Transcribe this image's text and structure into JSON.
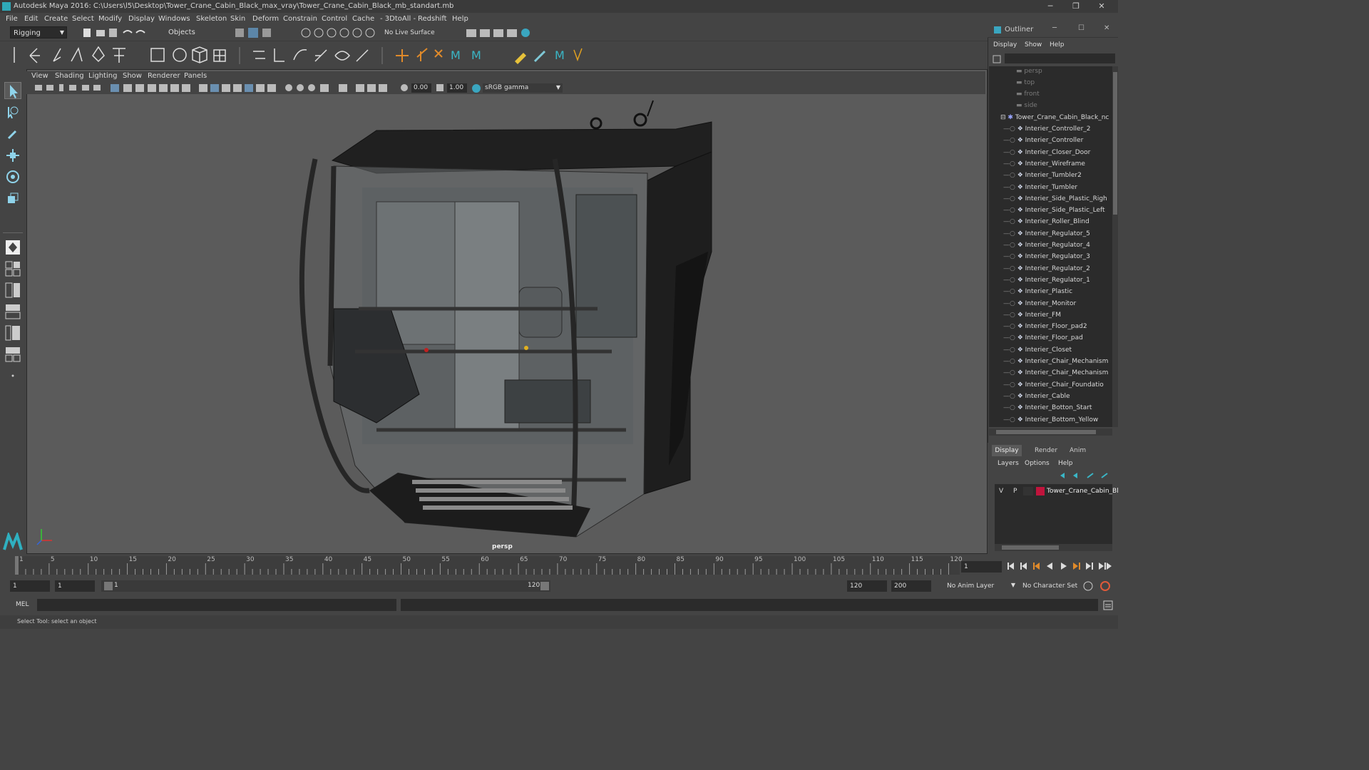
{
  "window": {
    "title": "Autodesk Maya 2016: C:\\Users\\l5\\Desktop\\Tower_Crane_Cabin_Black_max_vray\\Tower_Crane_Cabin_Black_mb_standart.mb",
    "minimize": "─",
    "maximize": "❐",
    "close": "✕"
  },
  "menubar": [
    "File",
    "Edit",
    "Create",
    "Select",
    "Modify",
    "Display",
    "Windows",
    "Skeleton",
    "Skin",
    "Deform",
    "Constrain",
    "Control",
    "Cache",
    "- 3DtoAll -",
    "Redshift",
    "Help"
  ],
  "statusline": {
    "mode": "Rigging",
    "select_mode": "Objects",
    "live_surface": "No Live Surface"
  },
  "viewport": {
    "menu": [
      "View",
      "Shading",
      "Lighting",
      "Show",
      "Renderer",
      "Panels"
    ],
    "exposure": "0.00",
    "gamma": "1.00",
    "color_space": "sRGB gamma",
    "camera_label": "persp"
  },
  "outliner": {
    "title": "Outliner",
    "menu": [
      "Display",
      "Show",
      "Help"
    ],
    "cameras": [
      "persp",
      "top",
      "front",
      "side"
    ],
    "root": "Tower_Crane_Cabin_Black_nc",
    "children": [
      "Interier_Controller_2",
      "Interier_Controller",
      "Interier_Closer_Door",
      "Interier_Wireframe",
      "Interier_Tumbler2",
      "Interier_Tumbler",
      "Interier_Side_Plastic_Righ",
      "Interier_Side_Plastic_Left",
      "Interier_Roller_Blind",
      "Interier_Regulator_5",
      "Interier_Regulator_4",
      "Interier_Regulator_3",
      "Interier_Regulator_2",
      "Interier_Regulator_1",
      "Interier_Plastic",
      "Interier_Monitor",
      "Interier_FM",
      "Interier_Floor_pad2",
      "Interier_Floor_pad",
      "Interier_Closet",
      "Interier_Chair_Mechanism",
      "Interier_Chair_Mechanism",
      "Interier_Chair_Foundatio",
      "Interier_Cable",
      "Interier_Botton_Start",
      "Interier_Bottom_Yellow"
    ]
  },
  "layers": {
    "tabs": [
      "Display",
      "Render",
      "Anim"
    ],
    "menu": [
      "Layers",
      "Options",
      "Help"
    ],
    "layer_v": "V",
    "layer_p": "P",
    "layer_name": "Tower_Crane_Cabin_Bl",
    "layer_color": "#c0143c"
  },
  "timeline": {
    "ticks": [
      "1",
      "5",
      "10",
      "15",
      "20",
      "25",
      "30",
      "35",
      "40",
      "45",
      "50",
      "55",
      "60",
      "65",
      "70",
      "75",
      "80",
      "85",
      "90",
      "95",
      "100",
      "105",
      "110",
      "115",
      "120"
    ],
    "current_frame": "1"
  },
  "range": {
    "start": "1",
    "playback_start": "1",
    "slider_start": "1",
    "slider_end": "120",
    "playback_end": "120",
    "end": "200",
    "anim_layer": "No Anim Layer",
    "character_set": "No Character Set"
  },
  "cmdline": {
    "label": "MEL"
  },
  "helpline": {
    "text": "Select Tool: select an object"
  }
}
